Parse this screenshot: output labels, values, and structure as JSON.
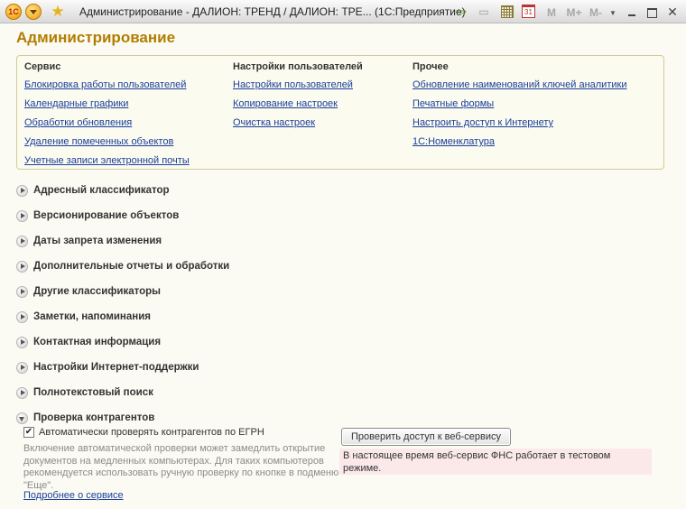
{
  "window": {
    "title": "Администрирование - ДАЛИОН: ТРЕНД / ДАЛИОН: ТРЕ...  (1С:Предприятие)",
    "logo_text": "1С",
    "memory_buttons": [
      "M",
      "M+",
      "M-"
    ],
    "calendar_day": "31"
  },
  "page": {
    "title": "Администрирование"
  },
  "sections": {
    "service": {
      "heading": "Сервис",
      "links": [
        "Блокировка работы пользователей",
        "Календарные графики",
        "Обработки обновления",
        "Удаление помеченных объектов",
        "Учетные записи электронной почты"
      ]
    },
    "user_settings": {
      "heading": "Настройки пользователей",
      "links": [
        "Настройки пользователей",
        "Копирование настроек",
        "Очистка настроек"
      ]
    },
    "other": {
      "heading": "Прочее",
      "links": [
        "Обновление наименований ключей аналитики",
        "Печатные формы",
        "Настроить доступ к Интернету",
        "1С:Номенклатура"
      ]
    }
  },
  "groups": [
    "Адресный классификатор",
    "Версионирование объектов",
    "Даты запрета изменения",
    "Дополнительные отчеты и обработки",
    "Другие классификаторы",
    "Заметки, напоминания",
    "Контактная информация",
    "Настройки Интернет-поддержки",
    "Полнотекстовый поиск",
    "Проверка контрагентов"
  ],
  "counterparty_check": {
    "checkbox_label": "Автоматически проверять контрагентов по ЕГРН",
    "checked": true,
    "hint": "Включение автоматической проверки может замедлить открытие документов на медленных компьютерах. Для таких компьютеров рекомендуется использовать ручную проверку по кнопке в подменю \"Еще\".",
    "more_link": "Подробнее о сервисе",
    "check_button": "Проверить доступ к веб-сервису",
    "status_message": "В настоящее время веб-сервис ФНС работает в тестовом режиме."
  }
}
